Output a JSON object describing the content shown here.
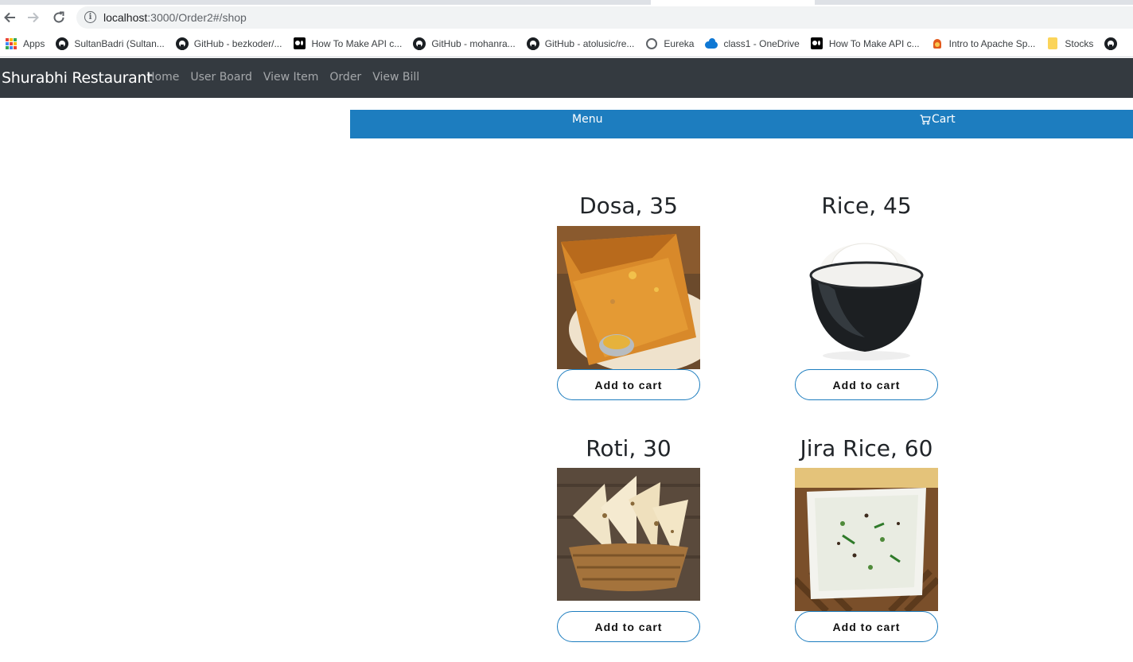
{
  "browser": {
    "url_host": "localhost",
    "url_path": ":3000/Order2#/shop",
    "bookmarks": [
      {
        "label": "Apps",
        "icon": "apps-grid-icon"
      },
      {
        "label": "SultanBadri (Sultan...",
        "icon": "github-icon"
      },
      {
        "label": "GitHub - bezkoder/...",
        "icon": "github-icon"
      },
      {
        "label": "How To Make API c...",
        "icon": "medium-icon"
      },
      {
        "label": "GitHub - mohanra...",
        "icon": "github-icon"
      },
      {
        "label": "GitHub - atolusic/re...",
        "icon": "github-icon"
      },
      {
        "label": "Eureka",
        "icon": "globe-icon"
      },
      {
        "label": "class1 - OneDrive",
        "icon": "onedrive-icon"
      },
      {
        "label": "How To Make API c...",
        "icon": "medium-icon"
      },
      {
        "label": "Intro to Apache Sp...",
        "icon": "spark-icon"
      },
      {
        "label": "Stocks",
        "icon": "folder-icon"
      }
    ]
  },
  "navbar": {
    "brand": "Shurabhi Restaurant",
    "links": [
      "Home",
      "User Board",
      "View Item",
      "Order",
      "View Bill"
    ],
    "bg_color": "#343a40"
  },
  "tabbar": {
    "menu_label": "Menu",
    "cart_label": "Cart",
    "bg_color": "#1d7dbf"
  },
  "products": [
    {
      "title": "Dosa, 35",
      "button": "Add to cart",
      "image": "dosa"
    },
    {
      "title": "Rice, 45",
      "button": "Add to cart",
      "image": "rice"
    },
    {
      "title": "Roti, 30",
      "button": "Add to cart",
      "image": "roti"
    },
    {
      "title": "Jira Rice, 60",
      "button": "Add to cart",
      "image": "jira-rice"
    }
  ]
}
